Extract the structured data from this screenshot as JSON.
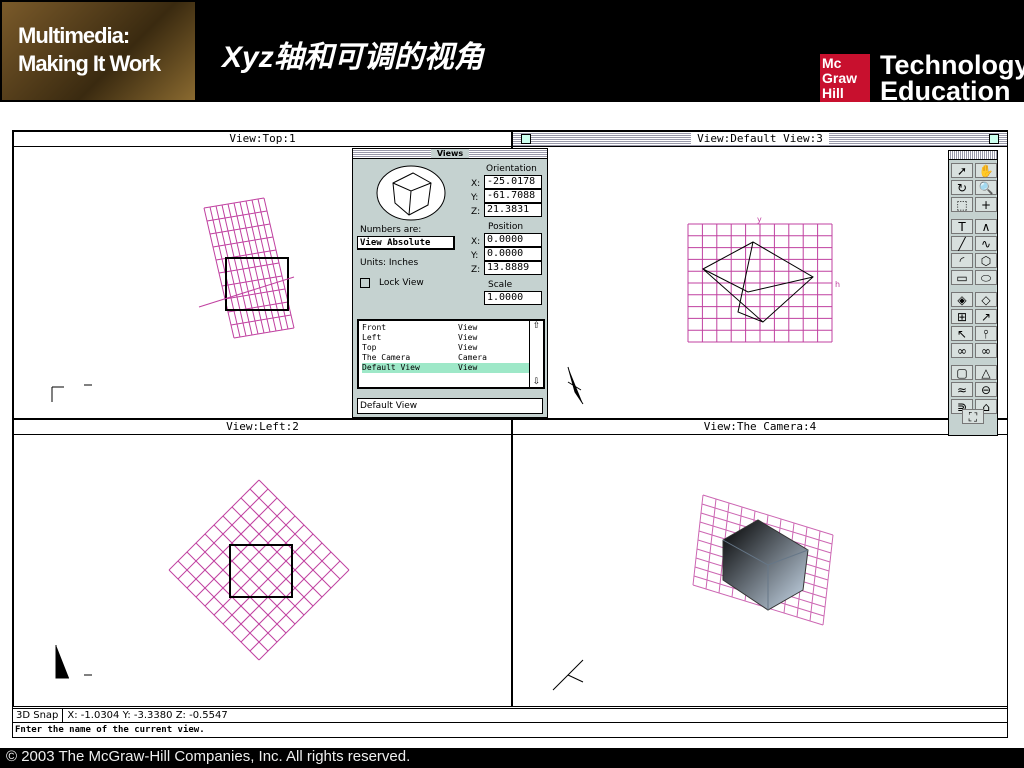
{
  "header": {
    "logo_text": "Multimedia: Making It Work",
    "title": "Xyz轴和可调的视角",
    "publisher_logo": "McGraw Hill",
    "publisher_text": "Technology Education"
  },
  "views": [
    {
      "title": "View:Top:1"
    },
    {
      "title": "View:Default View:3"
    },
    {
      "title": "View:Left:2"
    },
    {
      "title": "View:The Camera:4"
    }
  ],
  "palette": {
    "title": "Views",
    "orientation_label": "Orientation",
    "orientation": {
      "x": "-25.0178",
      "y": "-61.7088",
      "z": "21.3831"
    },
    "position_label": "Position",
    "position": {
      "x": "0.0000",
      "y": "0.0000",
      "z": "13.8889"
    },
    "scale_label": "Scale",
    "scale": "1.0000",
    "numbers_are_label": "Numbers are:",
    "numbers_are_value": "View Absolute",
    "units": "Units:  Inches",
    "lock_view": "Lock View",
    "axis_x": "X:",
    "axis_y": "Y:",
    "axis_z": "Z:",
    "list": [
      {
        "name": "Front",
        "type": "View"
      },
      {
        "name": "Left",
        "type": "View"
      },
      {
        "name": "Top",
        "type": "View"
      },
      {
        "name": "The Camera",
        "type": "Camera"
      },
      {
        "name": "Default View",
        "type": "View"
      }
    ],
    "name_input": "Default View"
  },
  "status": {
    "snap": "3D Snap",
    "coords": "X: -1.0304 Y: -3.3380 Z: -0.5547",
    "message": "Fnter the name of the current view."
  },
  "footer": "© 2003 The McGraw-Hill Companies, Inc. All rights reserved.",
  "tools": [
    "arrow",
    "hand",
    "rotate",
    "magnify",
    "marquee",
    "crosshair",
    "text",
    "polyline",
    "line",
    "curve",
    "arc",
    "polygon",
    "rectangle",
    "oval",
    "paint",
    "texture",
    "align",
    "bezier",
    "point-arrow",
    "pin",
    "link",
    "unlink",
    "box",
    "cone",
    "wave",
    "cylinder",
    "lathe",
    "camera",
    "fit"
  ],
  "colors": {
    "grid": "#c040a0",
    "panel": "#c5d2d0"
  }
}
